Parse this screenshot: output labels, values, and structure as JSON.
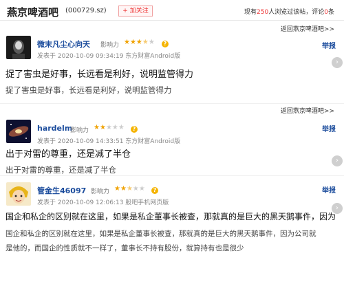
{
  "header": {
    "bar_name": "燕京啤酒吧",
    "stock_code": "(000729.sz)",
    "follow_label": "+ 加关注",
    "stats_prefix": "现有",
    "visitors": "250",
    "stats_mid": "人浏览过该帖，评论",
    "comments": "0",
    "stats_suffix": "条"
  },
  "back_link": "返回燕京啤酒吧>>",
  "influence_label": "影响力",
  "report_label": "举报",
  "posts": [
    {
      "username": "微末凡尘心向天",
      "stars": 3.5,
      "meta": "发表于 2020-10-09 09:34:19 东方财富Android版",
      "title": "捉了害虫是好事，长远看是利好，说明监管得力",
      "body": "捉了害虫是好事，长远看是利好，说明监管得力"
    },
    {
      "username": "hardelm",
      "stars": 2,
      "meta": "发表于 2020-10-09 14:33:51 东方财富Android版",
      "title": "出于对雷的尊重，还是减了半仓",
      "body": "出于对雷的尊重，还是减了半仓"
    },
    {
      "username": "管金生46097",
      "stars": 2.5,
      "meta": "发表于 2020-10-09 12:06:13 股吧手机网页版",
      "title": "国企和私企的区别就在这里，如果是私企董事长被查，那就真的是巨大的黑天鹅事件，因为",
      "body": "国企和私企的区别就在这里，如果是私企董事长被查，那就真的是巨大的黑天鹅事件，因为公司就",
      "body2": "是他的，而国企的性质就不一样了，董事长不持有股份，就算持有也是很少"
    }
  ],
  "icons": {
    "help": "question-mark",
    "scroll": "chevron-right"
  },
  "colors": {
    "username": "#1a4b9c",
    "star": "#f0a200",
    "accent": "#e33333"
  }
}
